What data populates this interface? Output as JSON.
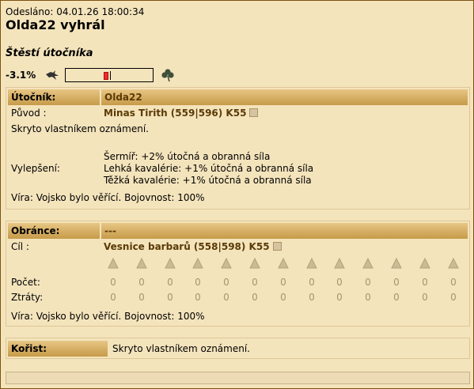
{
  "report": {
    "sent_label": "Odesláno: 04.01.26 18:00:34",
    "title": "Olda22 vyhrál",
    "luck_title": "Štěstí útočníka",
    "luck_value": "-3.1%",
    "luck_fraction": -0.031
  },
  "attacker": {
    "header_label": "Útočník:",
    "name": "Olda22",
    "origin_label": "Původ :",
    "origin_village": "Minas Tirith (559|596) K55",
    "hidden_text": "Skryto vlastníkem oznámení.",
    "upgrades_label": "Vylepšení:",
    "upgrades": [
      "Šermíř: +2% útočná a obranná síla",
      "Lehká kavalérie: +1% útočná a obranná síla",
      "Těžká kavalérie: +1% útočná a obranná síla"
    ],
    "faith": "Víra: Vojsko bylo věřící. Bojovnost: 100%"
  },
  "defender": {
    "header_label": "Obránce:",
    "name": "---",
    "target_label": "Cíl :",
    "target_village": "Vesnice barbarů (558|598) K55",
    "unit_icons": [
      "spear-icon",
      "sword-icon",
      "axe-icon",
      "archer-icon",
      "scout-icon",
      "light-cavalry-icon",
      "mounted-archer-icon",
      "heavy-cavalry-icon",
      "ram-icon",
      "catapult-icon",
      "knight-icon",
      "snob-icon",
      "militia-icon"
    ],
    "count_label": "Počet:",
    "losses_label": "Ztráty:",
    "counts": [
      "0",
      "0",
      "0",
      "0",
      "0",
      "0",
      "0",
      "0",
      "0",
      "0",
      "0",
      "0",
      "0"
    ],
    "losses": [
      "0",
      "0",
      "0",
      "0",
      "0",
      "0",
      "0",
      "0",
      "0",
      "0",
      "0",
      "0",
      "0"
    ],
    "faith": "Víra: Vojsko bylo věřící. Bojovnost: 100%"
  },
  "loot": {
    "label": "Kořist:",
    "value": "Skryto vlastníkem oznámení."
  }
}
